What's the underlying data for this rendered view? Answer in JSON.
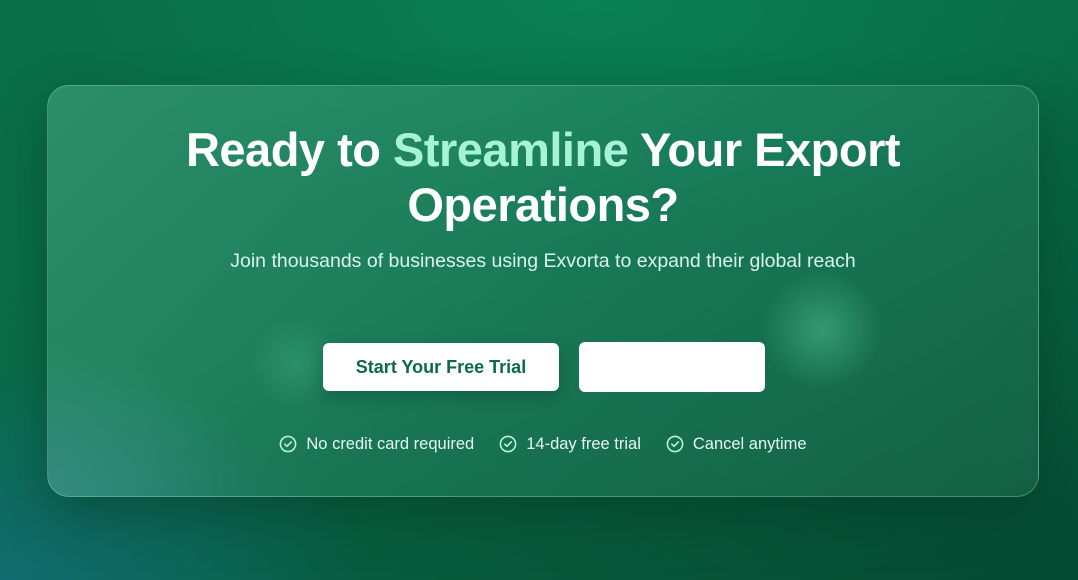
{
  "cta": {
    "headline_before": "Ready to ",
    "headline_accent": "Streamline",
    "headline_after": " Your Export Operations?",
    "subtitle": "Join thousands of businesses using Exvorta to expand their global reach",
    "primary_button_label": "Start Your Free Trial",
    "secondary_button_label": "",
    "features": [
      {
        "label": "No credit card required",
        "icon": "check-circle-icon"
      },
      {
        "label": "14-day free trial",
        "icon": "check-circle-icon"
      },
      {
        "label": "Cancel anytime",
        "icon": "check-circle-icon"
      }
    ]
  },
  "colors": {
    "accent": "#a7f3d6",
    "primary_button_text": "#0a6b47",
    "background": "#086b48"
  }
}
